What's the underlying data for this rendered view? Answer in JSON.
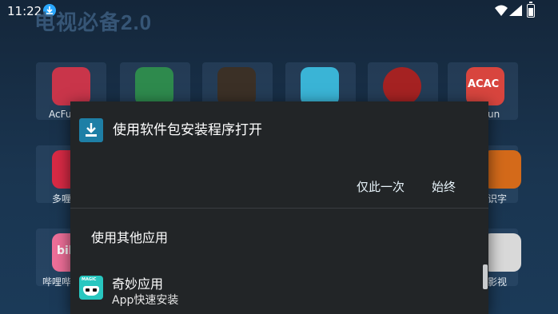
{
  "status_bar": {
    "time": "11:22"
  },
  "app": {
    "title": "电视必备2.0"
  },
  "grid_apps": [
    {
      "label": "AcFun",
      "color": "#c9354a"
    },
    {
      "label": "",
      "color": "#2e8a4d"
    },
    {
      "label": "",
      "color": "#3b3026"
    },
    {
      "label": "",
      "color": "#3ab4d6"
    },
    {
      "label": "",
      "color": "#a52222"
    },
    {
      "label": "un",
      "color": "#d8453e"
    },
    {
      "label": "多喱",
      "color": "#d92a45"
    },
    {
      "label": "识字",
      "color": "#d46a1a"
    },
    {
      "label": "哔哩哔",
      "color": "#ee6f99"
    },
    {
      "label": "影视",
      "color": "#d9d9d9"
    }
  ],
  "grid_icon_texts": {
    "acac": "ACAC",
    "bili": "bili"
  },
  "dialog": {
    "title": "使用软件包安装程序打开",
    "buttons": {
      "once": "仅此一次",
      "always": "始终"
    },
    "other_label": "使用其他应用",
    "option": {
      "name": "奇妙应用",
      "subtitle": "App快速安装",
      "badge": "MAGIC"
    }
  },
  "colors": {
    "accent": "#1e7fa6",
    "dialog_bg": "#222527",
    "magic_app": "#28c7c0"
  }
}
